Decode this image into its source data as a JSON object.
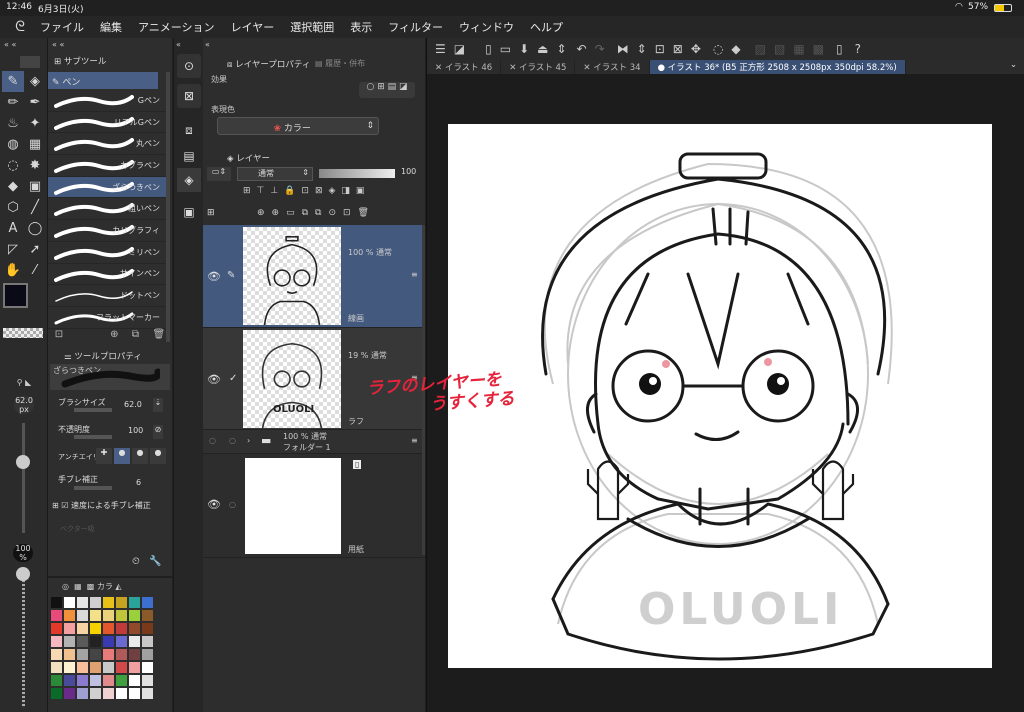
{
  "status": {
    "time": "12:46",
    "date": "6月3日(火)",
    "battery": "57%"
  },
  "menu": [
    "ファイル",
    "編集",
    "アニメーション",
    "レイヤー",
    "選択範囲",
    "表示",
    "フィルター",
    "ウィンドウ",
    "ヘルプ"
  ],
  "subtool": {
    "tab": "サブツール",
    "group": "ペン",
    "brushes": [
      "Gペン",
      "リアルGペン",
      "丸ペン",
      "カブラペン",
      "ざらつきペン",
      "粗いペン",
      "カリグラフィ",
      "ミリペン",
      "サインペン",
      "ドットペン",
      "フラットマーカー"
    ],
    "selected_index": 4
  },
  "toolprop": {
    "title": "ツールプロパティ",
    "brush_name": "ざらつきペン",
    "size_label": "ブラシサイズ",
    "size_value": "62.0",
    "opacity_label": "不透明度",
    "opacity_value": "100",
    "aa_label": "アンチエイリ",
    "stab_label": "手ブレ補正",
    "stab_value": "6",
    "speed_label": "速度による手ブレ補正",
    "vector_label": "ベクター吸",
    "size_display": "62.0",
    "size_unit": "px",
    "opacity_display": "100",
    "opacity_unit": "%"
  },
  "colorset": {
    "tab": "カラ",
    "swatches": [
      "#111111",
      "#ffffff",
      "#e6e6e6",
      "#cfcfcf",
      "#e8c01a",
      "#c5a21f",
      "#2aa39a",
      "#3d6fcf",
      "#e84a7a",
      "#f0903a",
      "#d9d9d9",
      "#f5e08a",
      "#ead27a",
      "#c0c63a",
      "#9ad13a",
      "#8a5a2a",
      "#e2392a",
      "#f5a0a0",
      "#f7d2a4",
      "#f5d200",
      "#e4572e",
      "#c23b3b",
      "#914a2a",
      "#7a3a1a",
      "#f6b8c0",
      "#b3b3b3",
      "#5a5a5a",
      "#222222",
      "#3a3ab0",
      "#6a6ad0",
      "#eaeaea",
      "#c8c8c8",
      "#f7d9b3",
      "#f0c090",
      "#a3a3a3",
      "#454545",
      "#e97a7a",
      "#b05a5a",
      "#704040",
      "#a0a0a0",
      "#f0e0c0",
      "#fff2d0",
      "#f7c09a",
      "#e0a070",
      "#c8c8c8",
      "#d04a4a",
      "#f0a0a0",
      "#ffffff",
      "#2a8a3a",
      "#4a4a9a",
      "#8a7ad0",
      "#c0c0e0",
      "#e08a8a",
      "#40a040",
      "#ffffff",
      "#e0e0e0",
      "#0a6a2a",
      "#6a2a8a",
      "#a0a0d0",
      "#d0d0d0",
      "#f0d0d0",
      "#ffffff",
      "#ffffff",
      "#e0e0e0"
    ]
  },
  "layerprop": {
    "tab": "レイヤープロパティ",
    "tab2": "履歴・併布",
    "effect_label": "効果",
    "expr_label": "表現色",
    "expr_value": "カラー"
  },
  "layers": {
    "tab": "レイヤー",
    "blend": "通常",
    "opacity": "100",
    "items": [
      {
        "percent": "100 %  通常",
        "name": "線画"
      },
      {
        "percent": "19 %  通常",
        "name": "ラフ"
      },
      {
        "percent": "100 %  通常",
        "name": "フォルダー 1"
      },
      {
        "percent": "",
        "name": "用紙"
      }
    ]
  },
  "annotation": {
    "line1": "ラフのレイヤーを",
    "line2": "うすくする",
    "color": "#e5233b"
  },
  "canvas": {
    "tabs": [
      "イラスト 46",
      "イラスト 45",
      "イラスト 34",
      "● イラスト 36* (B5 正方形 2508 x 2508px 350dpi 58.2%)"
    ],
    "shirt_text": "OLUOLI",
    "rough_text": "OLUOLI"
  }
}
